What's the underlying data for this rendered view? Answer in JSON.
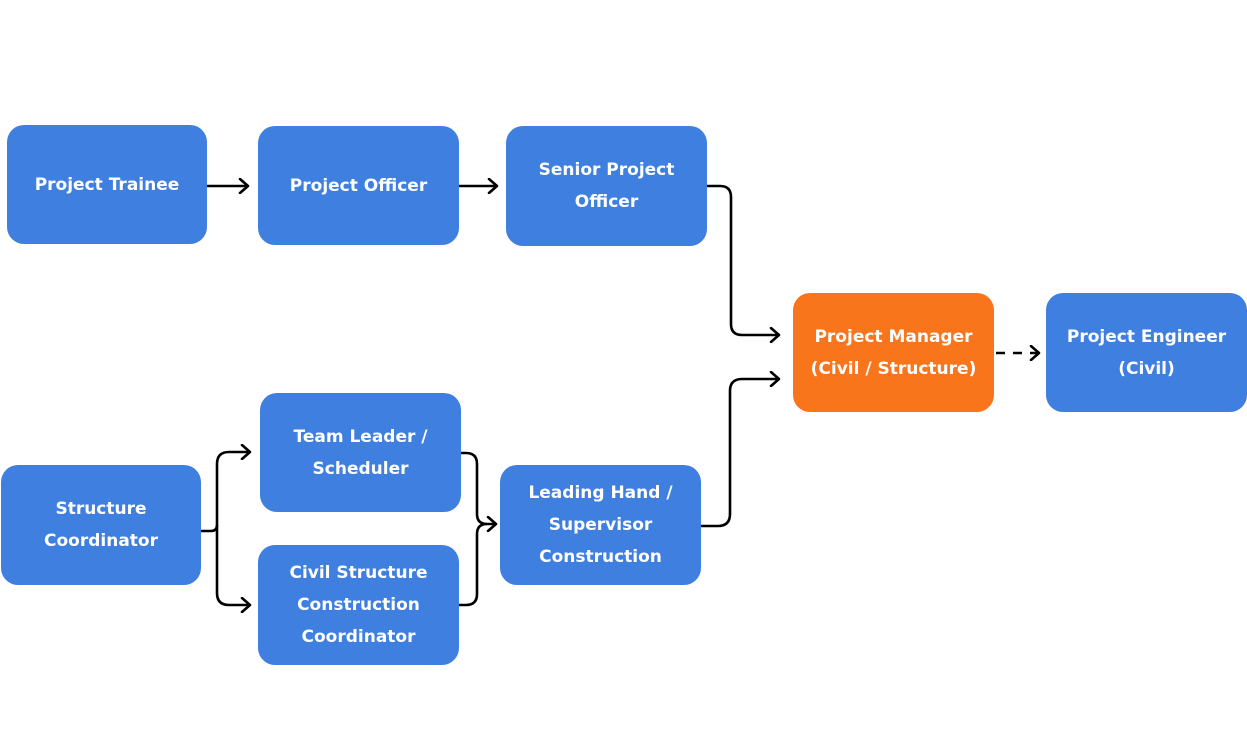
{
  "colors": {
    "node_default": "#3F7FE0",
    "node_highlight": "#F9751B",
    "connector": "#000000",
    "text": "#FFFFFF"
  },
  "nodes": [
    {
      "id": "project-trainee",
      "label": "Project Trainee",
      "highlight": false
    },
    {
      "id": "project-officer",
      "label": "Project Officer",
      "highlight": false
    },
    {
      "id": "senior-project-officer",
      "label": "Senior Project\nOfficer",
      "highlight": false
    },
    {
      "id": "project-manager",
      "label": "Project Manager\n(Civil / Structure)",
      "highlight": true
    },
    {
      "id": "project-engineer",
      "label": "Project Engineer\n(Civil)",
      "highlight": false
    },
    {
      "id": "structure-coordinator",
      "label": "Structure\nCoordinator",
      "highlight": false
    },
    {
      "id": "team-leader-scheduler",
      "label": "Team Leader /\nScheduler",
      "highlight": false
    },
    {
      "id": "civil-structure-construction-coordinator",
      "label": "Civil Structure\nConstruction\nCoordinator",
      "highlight": false
    },
    {
      "id": "leading-hand-supervisor-construction",
      "label": "Leading Hand /\nSupervisor\nConstruction",
      "highlight": false
    }
  ],
  "edges": [
    {
      "from": "project-trainee",
      "to": "project-officer",
      "style": "solid"
    },
    {
      "from": "project-officer",
      "to": "senior-project-officer",
      "style": "solid"
    },
    {
      "from": "senior-project-officer",
      "to": "project-manager",
      "style": "solid"
    },
    {
      "from": "structure-coordinator",
      "to": "team-leader-scheduler",
      "style": "solid"
    },
    {
      "from": "structure-coordinator",
      "to": "civil-structure-construction-coordinator",
      "style": "solid"
    },
    {
      "from": "team-leader-scheduler",
      "to": "leading-hand-supervisor-construction",
      "style": "solid"
    },
    {
      "from": "civil-structure-construction-coordinator",
      "to": "leading-hand-supervisor-construction",
      "style": "solid"
    },
    {
      "from": "leading-hand-supervisor-construction",
      "to": "project-manager",
      "style": "solid"
    },
    {
      "from": "project-manager",
      "to": "project-engineer",
      "style": "dashed"
    }
  ]
}
